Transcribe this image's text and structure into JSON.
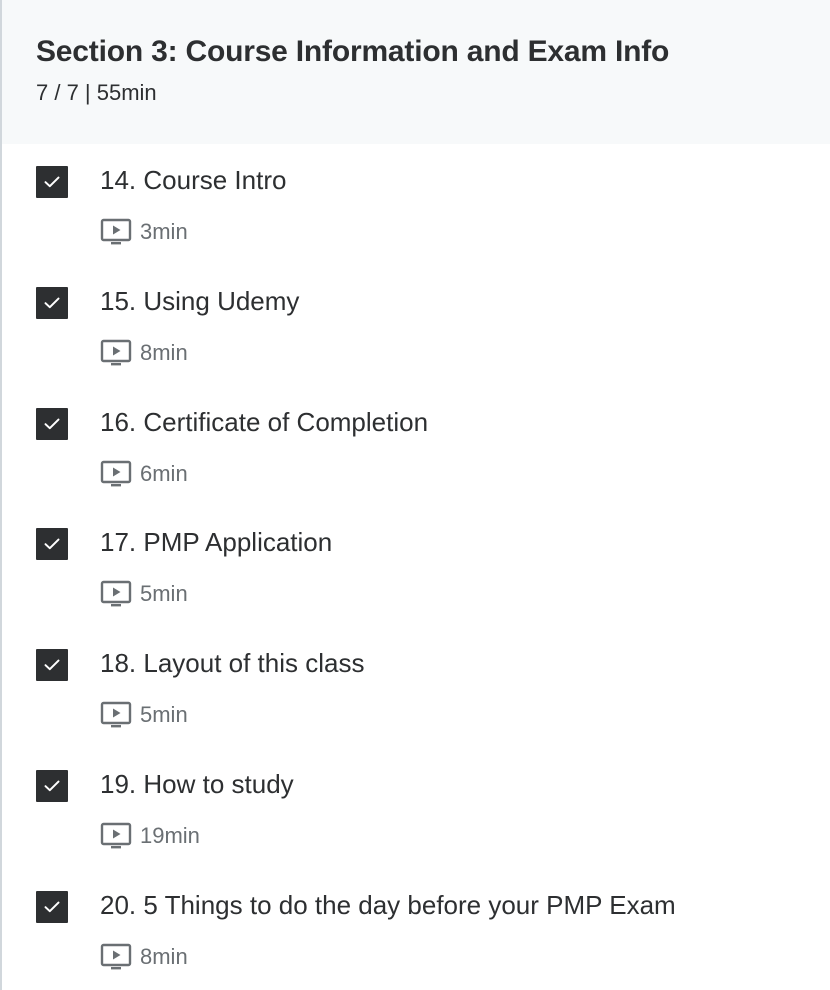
{
  "section": {
    "title": "Section 3: Course Information and Exam Info",
    "progress": "7 / 7 | 55min"
  },
  "lectures": [
    {
      "title": "14. Course Intro",
      "duration": "3min",
      "completed": true,
      "icon": "video-icon"
    },
    {
      "title": "15. Using Udemy",
      "duration": "8min",
      "completed": true,
      "icon": "video-icon"
    },
    {
      "title": "16. Certificate of Completion",
      "duration": "6min",
      "completed": true,
      "icon": "video-icon"
    },
    {
      "title": "17. PMP Application",
      "duration": "5min",
      "completed": true,
      "icon": "video-icon"
    },
    {
      "title": "18. Layout of this class",
      "duration": "5min",
      "completed": true,
      "icon": "video-icon"
    },
    {
      "title": "19. How to study",
      "duration": "19min",
      "completed": true,
      "icon": "video-icon"
    },
    {
      "title": "20. 5 Things to do the day before your PMP Exam",
      "duration": "8min",
      "completed": true,
      "icon": "video-icon"
    }
  ],
  "colors": {
    "header_bg": "#f7f9fa",
    "checkbox_fill": "#2d2f31",
    "text_primary": "#2d2f31",
    "text_secondary": "#6a6f73"
  }
}
